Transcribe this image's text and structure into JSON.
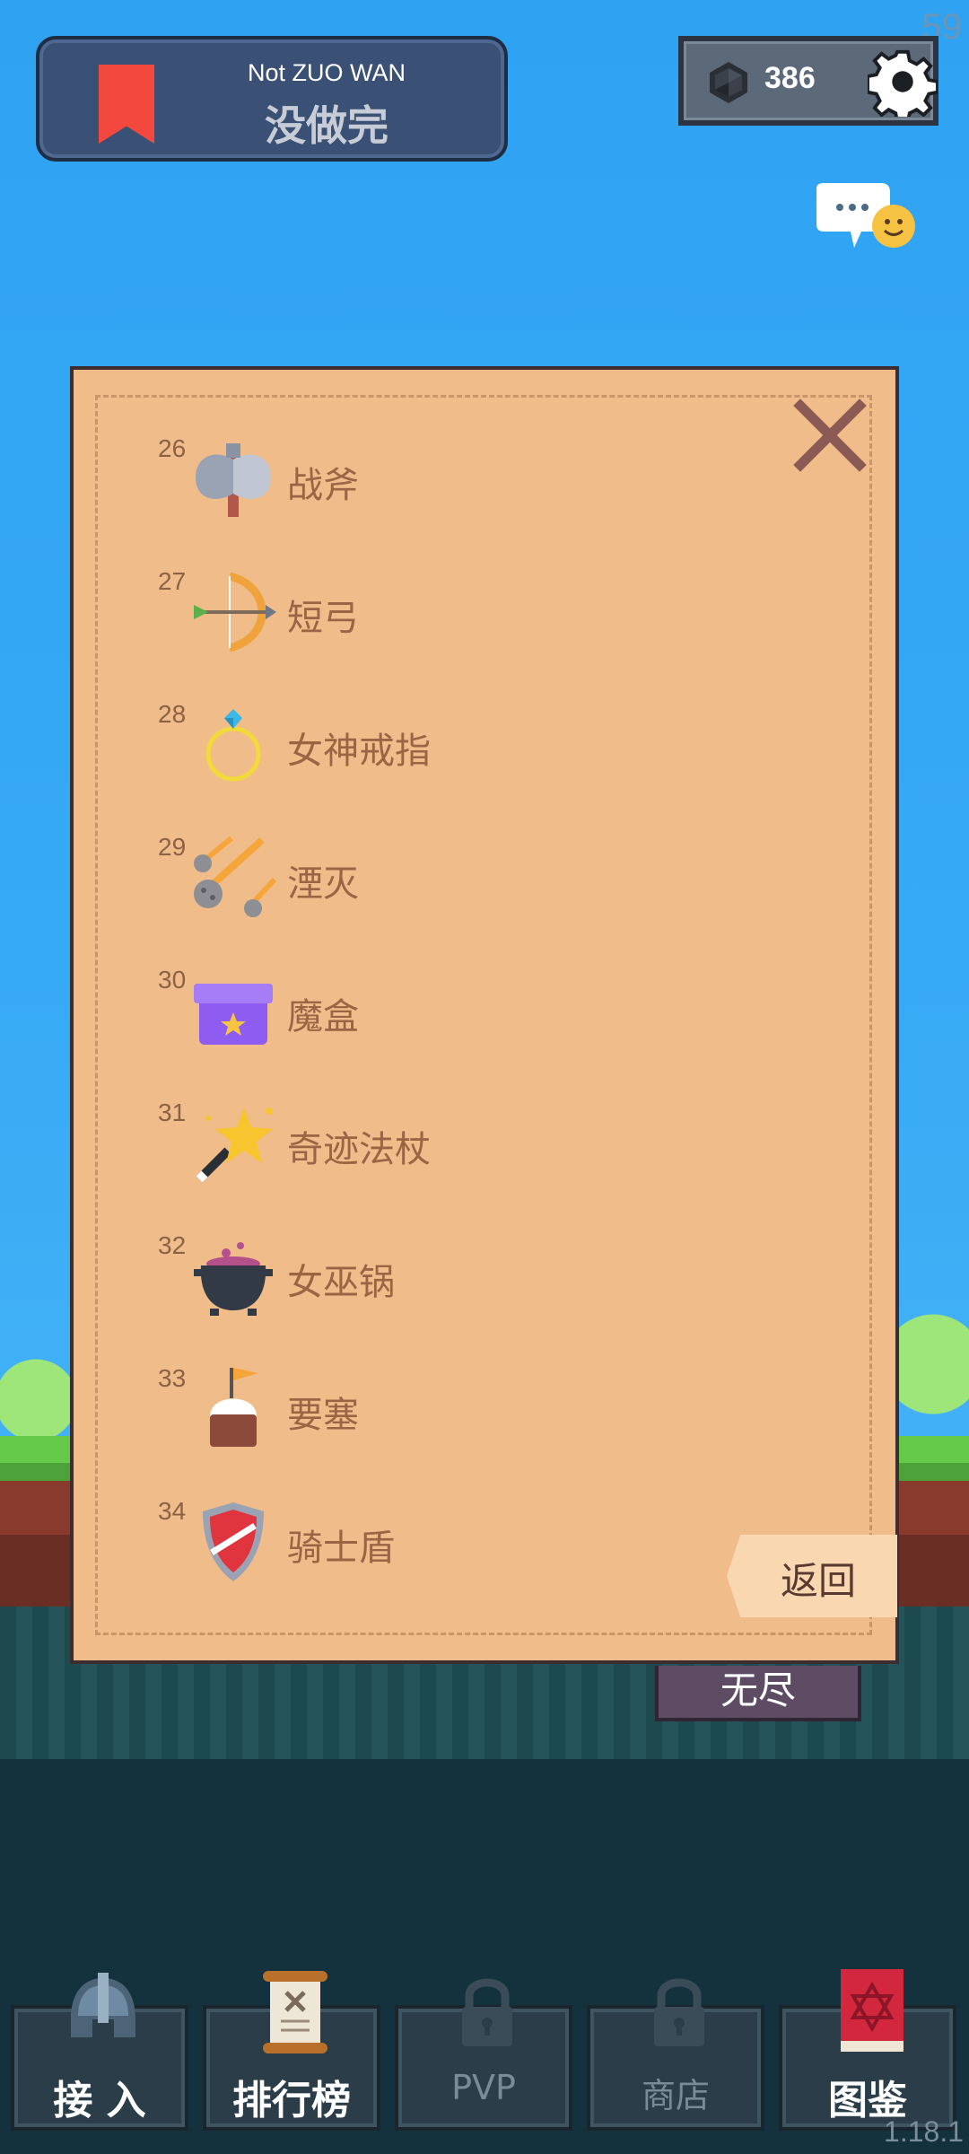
{
  "status": {
    "fps": "59",
    "version": "1.18.1"
  },
  "header": {
    "title_en": "Not ZUO WAN",
    "title_cn": "没做完",
    "gem_count": "386",
    "icons": {
      "bookmark": "bookmark-icon",
      "gem": "gem-icon",
      "settings": "gear-icon",
      "chat": "chat-bubble-icon"
    }
  },
  "codex": {
    "items": [
      {
        "num": "26",
        "name": "战斧",
        "icon": "battle-axe-icon"
      },
      {
        "num": "27",
        "name": "短弓",
        "icon": "short-bow-icon"
      },
      {
        "num": "28",
        "name": "女神戒指",
        "icon": "goddess-ring-icon"
      },
      {
        "num": "29",
        "name": "湮灭",
        "icon": "meteor-icon"
      },
      {
        "num": "30",
        "name": "魔盒",
        "icon": "magic-box-icon"
      },
      {
        "num": "31",
        "name": "奇迹法杖",
        "icon": "miracle-wand-icon"
      },
      {
        "num": "32",
        "name": "女巫锅",
        "icon": "witch-cauldron-icon"
      },
      {
        "num": "33",
        "name": "要塞",
        "icon": "fortress-icon"
      },
      {
        "num": "34",
        "name": "骑士盾",
        "icon": "knight-shield-icon"
      }
    ],
    "back_label": "返回",
    "close_icon": "close-icon"
  },
  "mode_tab": {
    "label": "无尽"
  },
  "bottom_nav": [
    {
      "label": "接 入",
      "icon": "helmet-icon",
      "locked": false
    },
    {
      "label": "排行榜",
      "icon": "scroll-icon",
      "locked": false
    },
    {
      "label": "PVP",
      "icon": "lock-icon",
      "locked": true
    },
    {
      "label": "商店",
      "icon": "lock-icon",
      "locked": true
    },
    {
      "label": "图鉴",
      "icon": "codex-book-icon",
      "locked": false
    }
  ],
  "colors": {
    "sky": "#31a4f2",
    "panel": "#efbc8a",
    "item_text": "#9b6445",
    "close": "#8c5a55",
    "header_card": "#3a5074"
  }
}
